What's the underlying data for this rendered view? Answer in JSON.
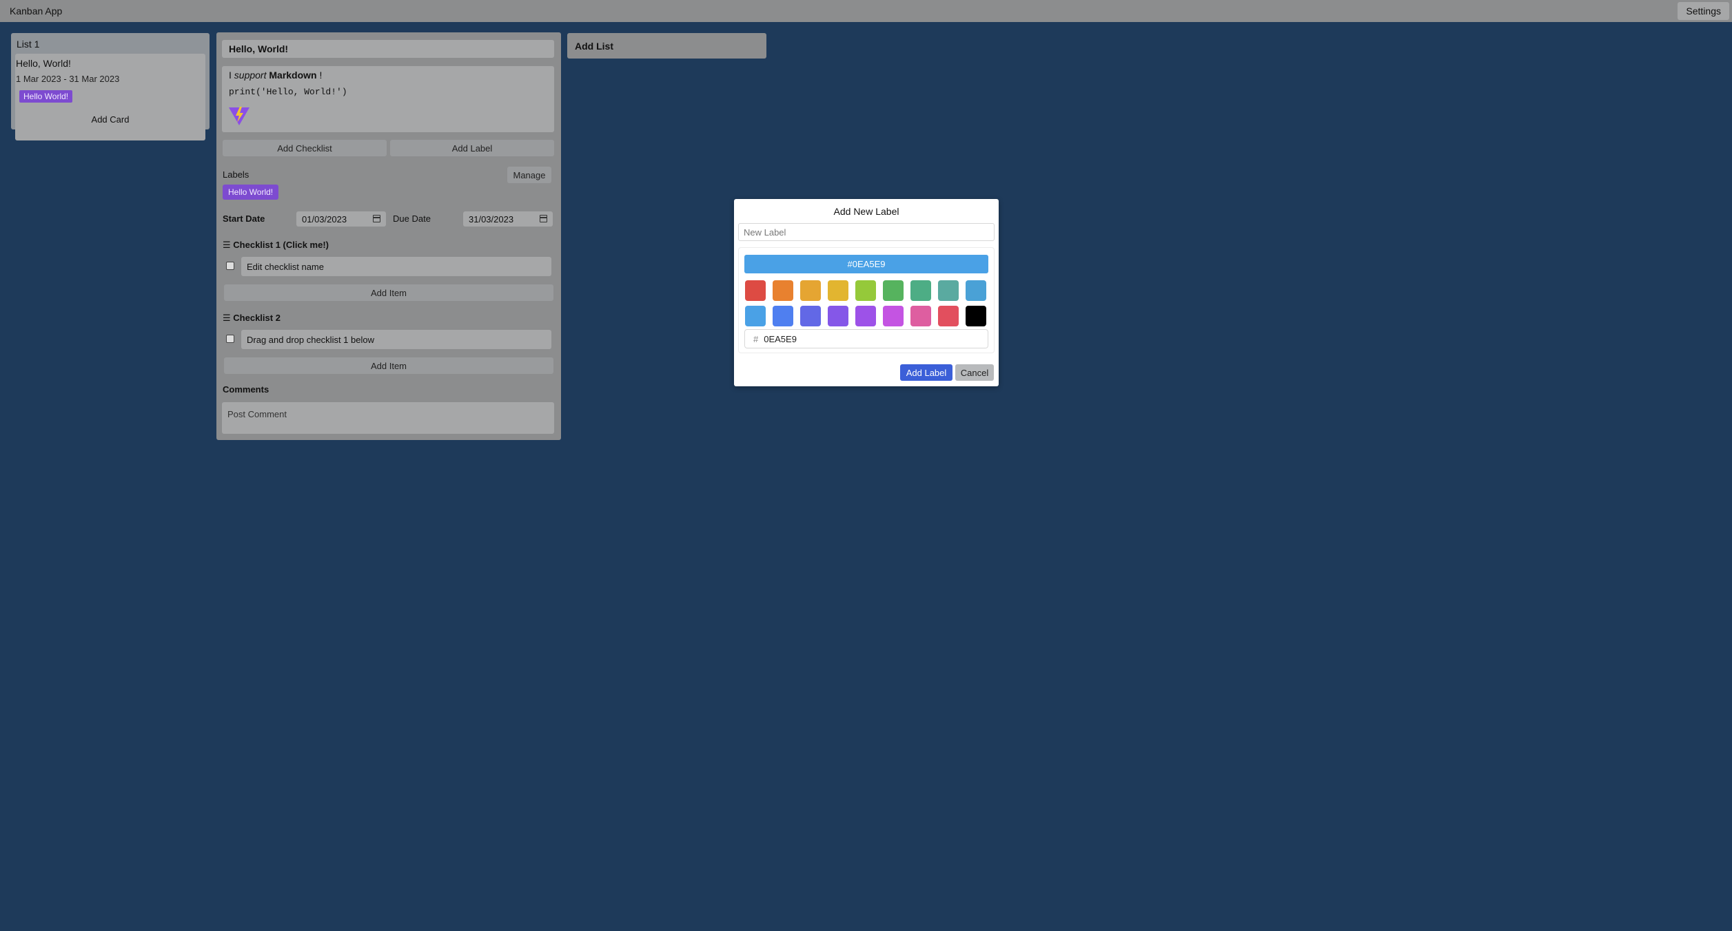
{
  "app": {
    "title": "Kanban App",
    "settings_label": "Settings"
  },
  "list": {
    "title": "List 1",
    "card": {
      "title": "Hello, World!",
      "dates": "1 Mar 2023 - 31 Mar 2023",
      "label": "Hello World!"
    },
    "add_card_label": "Add Card"
  },
  "detail": {
    "title": "Hello, World!",
    "description": {
      "prefix": "I ",
      "emphasis": "support",
      "middle": " ",
      "strong": "Markdown",
      "suffix": " !",
      "code": "print('Hello, World!')",
      "image_icon": "vite-logo-icon"
    },
    "add_checklist_label": "Add Checklist",
    "add_label_label": "Add Label",
    "labels_heading": "Labels",
    "manage_label": "Manage",
    "labels": [
      "Hello World!"
    ],
    "start_date_label": "Start Date",
    "start_date_value": "01/03/2023",
    "due_date_label": "Due Date",
    "due_date_value": "31/03/2023",
    "checklists": [
      {
        "title": "Checklist 1 (Click me!)",
        "items": [
          "Edit checklist name"
        ],
        "add_item_label": "Add Item"
      },
      {
        "title": "Checklist 2",
        "items": [
          "Drag and drop checklist 1 below"
        ],
        "add_item_label": "Add Item"
      }
    ],
    "comments_heading": "Comments",
    "comment_placeholder": "Post Comment"
  },
  "add_list_label": "Add List",
  "modal": {
    "title": "Add New Label",
    "input_placeholder": "New Label",
    "selected_color_label": "#0EA5E9",
    "selected_color_display": "#4aa1e6",
    "hex_prefix": "#",
    "hex_value": "0EA5E9",
    "swatches_row1": [
      "#dd4b43",
      "#e8812f",
      "#e5a532",
      "#e2b530",
      "#95c93a",
      "#56b35e",
      "#4dad85",
      "#5aaaa0",
      "#4aa1d6"
    ],
    "swatches_row2": [
      "#4aa1e6",
      "#4f7ff0",
      "#6268e6",
      "#8557e8",
      "#9d52e8",
      "#c454e2",
      "#de5ea0",
      "#e24f5e",
      "#000000"
    ],
    "add_label_button": "Add Label",
    "cancel_button": "Cancel"
  },
  "colors": {
    "background": "#1e3a5a",
    "panel": "#8c8d8e",
    "field": "#a6a7a8",
    "label_purple": "#7d4bd0",
    "primary_button": "#3b5fd8"
  }
}
